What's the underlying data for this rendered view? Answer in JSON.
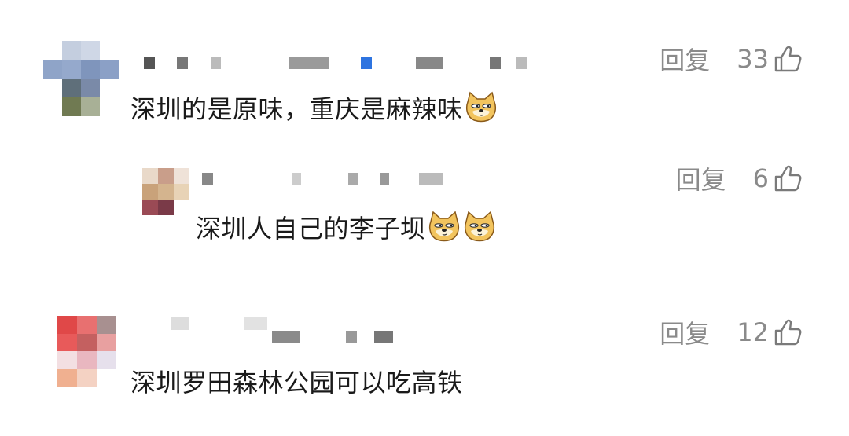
{
  "comments": [
    {
      "text": "深圳的是原味，重庆是麻辣味",
      "reply_label": "回复",
      "likes": "33",
      "emoji": "doge-emoji",
      "emoji_count": 1
    },
    {
      "text": "深圳人自己的李子坝",
      "reply_label": "回复",
      "likes": "6",
      "emoji": "doge-emoji",
      "emoji_count": 2,
      "is_reply": true
    },
    {
      "text": "深圳罗田森林公园可以吃高铁",
      "reply_label": "回复",
      "likes": "12",
      "emoji_count": 0
    }
  ],
  "icons": {
    "like": "thumbs-up-icon",
    "emoji": "doge-emoji"
  },
  "colors": {
    "text": "#1a1a1a",
    "meta": "#8a8a8a",
    "background": "#ffffff"
  }
}
